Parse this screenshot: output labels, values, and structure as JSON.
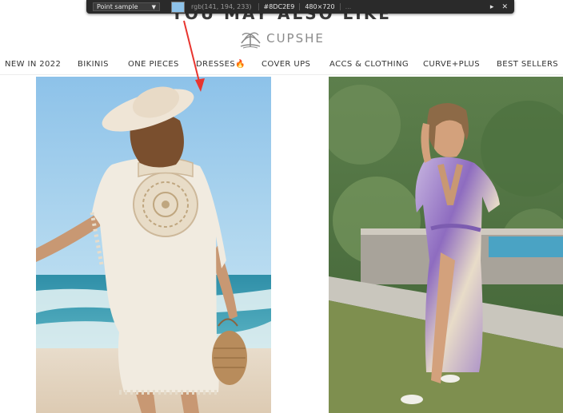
{
  "section_heading": "YOU MAY ALSO LIKE",
  "color_picker": {
    "mode": "Point sample",
    "rgb": "rgb(141, 194, 233)",
    "hex": "#8DC2E9",
    "dimensions": "480×720",
    "extra": "...",
    "swatch_color": "#8DC2E9",
    "expand_icon": "▸",
    "close_icon": "✕"
  },
  "brand": {
    "name": "CUPSHE",
    "logo_icon": "palm-tree-umbrella-icon"
  },
  "nav": [
    "NEW IN 2022",
    "BIKINIS",
    "ONE PIECES",
    "DRESSES🔥",
    "COVER UPS",
    "ACCS & CLOTHING",
    "CURVE+PLUS",
    "BEST SELLERS"
  ],
  "products": [
    {
      "name": "white-crochet-tassel-cover-up-photo"
    },
    {
      "name": "purple-tie-dye-wrap-maxi-dress-photo"
    }
  ],
  "annotation": {
    "arrow_color": "#e8352f"
  }
}
